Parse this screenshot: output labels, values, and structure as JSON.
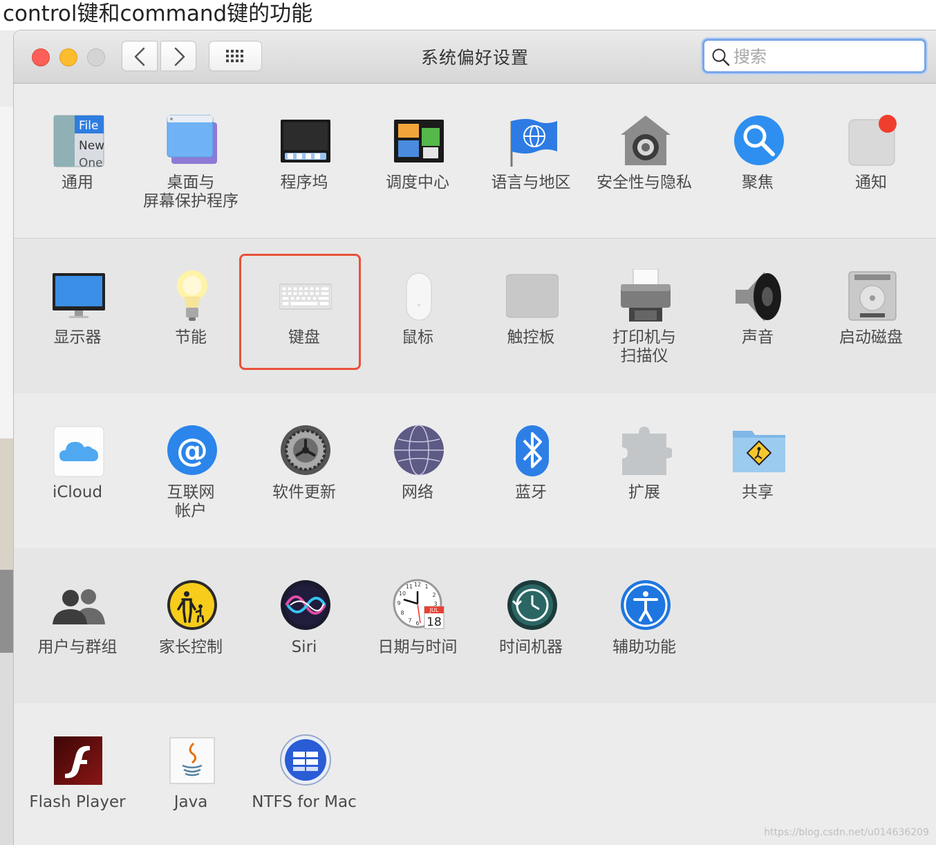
{
  "caption": "control键和command键的功能",
  "window": {
    "title": "系统偏好设置",
    "search_placeholder": "搜索"
  },
  "sections": [
    [
      {
        "label": "通用",
        "icon": "general-icon"
      },
      {
        "label": "桌面与\n屏幕保护程序",
        "icon": "desktop-icon"
      },
      {
        "label": "程序坞",
        "icon": "dock-icon"
      },
      {
        "label": "调度中心",
        "icon": "mission-control-icon"
      },
      {
        "label": "语言与地区",
        "icon": "language-region-icon"
      },
      {
        "label": "安全性与隐私",
        "icon": "security-icon"
      },
      {
        "label": "聚焦",
        "icon": "spotlight-icon"
      },
      {
        "label": "通知",
        "icon": "notifications-icon"
      }
    ],
    [
      {
        "label": "显示器",
        "icon": "display-icon"
      },
      {
        "label": "节能",
        "icon": "energy-saver-icon"
      },
      {
        "label": "键盘",
        "icon": "keyboard-icon"
      },
      {
        "label": "鼠标",
        "icon": "mouse-icon"
      },
      {
        "label": "触控板",
        "icon": "trackpad-icon"
      },
      {
        "label": "打印机与\n扫描仪",
        "icon": "printer-icon"
      },
      {
        "label": "声音",
        "icon": "sound-icon"
      },
      {
        "label": "启动磁盘",
        "icon": "startup-disk-icon"
      }
    ],
    [
      {
        "label": "iCloud",
        "icon": "icloud-icon"
      },
      {
        "label": "互联网\n帐户",
        "icon": "internet-accounts-icon"
      },
      {
        "label": "软件更新",
        "icon": "software-update-icon"
      },
      {
        "label": "网络",
        "icon": "network-icon"
      },
      {
        "label": "蓝牙",
        "icon": "bluetooth-icon"
      },
      {
        "label": "扩展",
        "icon": "extensions-icon"
      },
      {
        "label": "共享",
        "icon": "sharing-icon"
      }
    ],
    [
      {
        "label": "用户与群组",
        "icon": "users-groups-icon"
      },
      {
        "label": "家长控制",
        "icon": "parental-controls-icon"
      },
      {
        "label": "Siri",
        "icon": "siri-icon"
      },
      {
        "label": "日期与时间",
        "icon": "date-time-icon"
      },
      {
        "label": "时间机器",
        "icon": "time-machine-icon"
      },
      {
        "label": "辅助功能",
        "icon": "accessibility-icon"
      }
    ],
    [
      {
        "label": "Flash Player",
        "icon": "flash-player-icon"
      },
      {
        "label": "Java",
        "icon": "java-icon"
      },
      {
        "label": "NTFS for Mac",
        "icon": "ntfs-icon"
      }
    ]
  ],
  "general_icon_text": [
    "File",
    "New",
    "One"
  ],
  "calendar_icon_text": {
    "month": "JUL",
    "day": "18"
  },
  "highlighted_item": "键盘",
  "watermark": "https://blog.csdn.net/u014636209",
  "colors": {
    "highlight": "#e8523a",
    "search_focus": "#7aa6ea"
  }
}
